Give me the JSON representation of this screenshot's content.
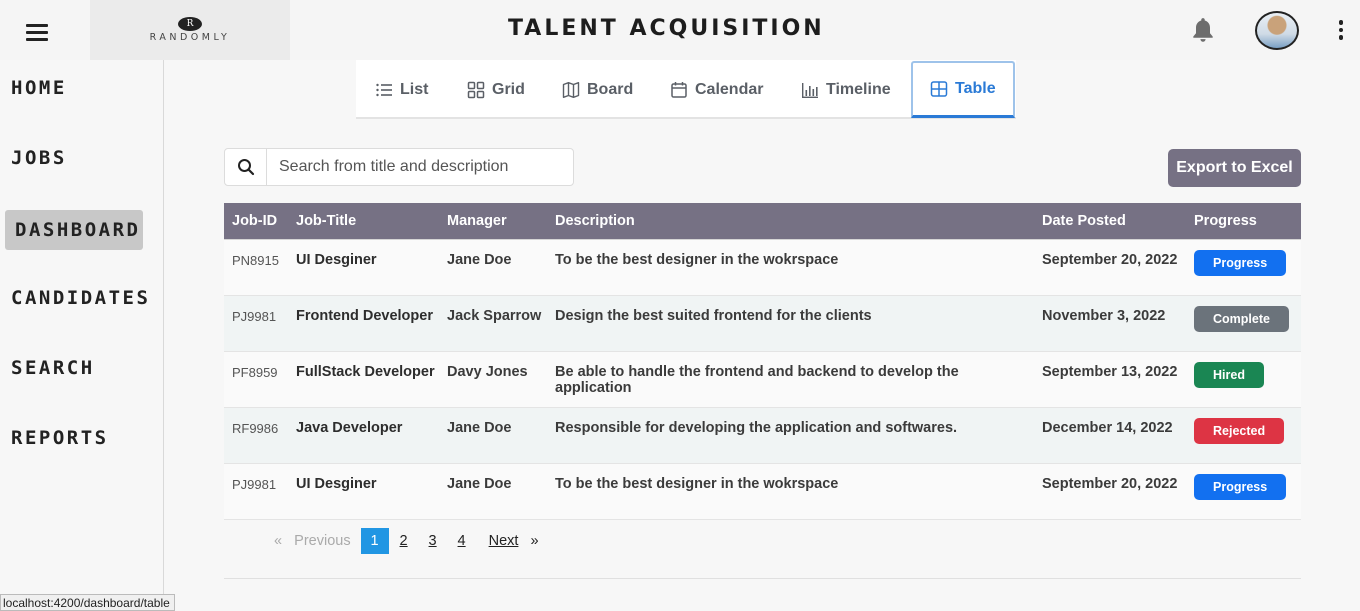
{
  "header": {
    "logo_mark": "R",
    "logo_text": "RANDOMLY",
    "title": "TALENT ACQUISITION"
  },
  "sidebar": {
    "items": [
      {
        "label": "HOME",
        "active": false
      },
      {
        "label": "JOBS",
        "active": false
      },
      {
        "label": "DASHBOARD",
        "active": true
      },
      {
        "label": "CANDIDATES",
        "active": false
      },
      {
        "label": "SEARCH",
        "active": false
      },
      {
        "label": "REPORTS",
        "active": false
      }
    ]
  },
  "view_tabs": [
    {
      "label": "List",
      "icon": "list-icon"
    },
    {
      "label": "Grid",
      "icon": "grid-icon"
    },
    {
      "label": "Board",
      "icon": "map-icon"
    },
    {
      "label": "Calendar",
      "icon": "calendar-icon"
    },
    {
      "label": "Timeline",
      "icon": "bar-chart-icon"
    },
    {
      "label": "Table",
      "icon": "table-icon",
      "active": true
    }
  ],
  "search": {
    "placeholder": "Search from title and description",
    "value": ""
  },
  "export_label": "Export to Excel",
  "table": {
    "columns": [
      "Job-ID",
      "Job-Title",
      "Manager",
      "Description",
      "Date Posted",
      "Progress"
    ],
    "rows": [
      {
        "id": "PN8915",
        "title": "UI Desginer",
        "manager": "Jane Doe",
        "description": "To be the best designer in the wokrspace",
        "date": "September 20, 2022",
        "status": "Progress",
        "status_color": "#1270f0"
      },
      {
        "id": "PJ9981",
        "title": "Frontend Developer",
        "manager": "Jack Sparrow",
        "description": "Design the best suited frontend for the clients",
        "date": "November 3, 2022",
        "status": "Complete",
        "status_color": "#6b737b"
      },
      {
        "id": "PF8959",
        "title": "FullStack Developer",
        "manager": "Davy Jones",
        "description": "Be able to handle the frontend and backend to develop the application",
        "date": "September 13, 2022",
        "status": "Hired",
        "status_color": "#1a8653"
      },
      {
        "id": "RF9986",
        "title": "Java Developer",
        "manager": "Jane Doe",
        "description": "Responsible for developing the application and softwares.",
        "date": "December 14, 2022",
        "status": "Rejected",
        "status_color": "#dd3444"
      },
      {
        "id": "PJ9981",
        "title": "UI Desginer",
        "manager": "Jane Doe",
        "description": "To be the best designer in the wokrspace",
        "date": "September 20, 2022",
        "status": "Progress",
        "status_color": "#1270f0"
      }
    ]
  },
  "pagination": {
    "prev_label": "Previous",
    "prev_arrow": "«",
    "pages": [
      "1",
      "2",
      "3",
      "4"
    ],
    "current": "1",
    "next_label": "Next",
    "next_arrow": "»"
  },
  "status_bar_url": "localhost:4200/dashboard/table"
}
